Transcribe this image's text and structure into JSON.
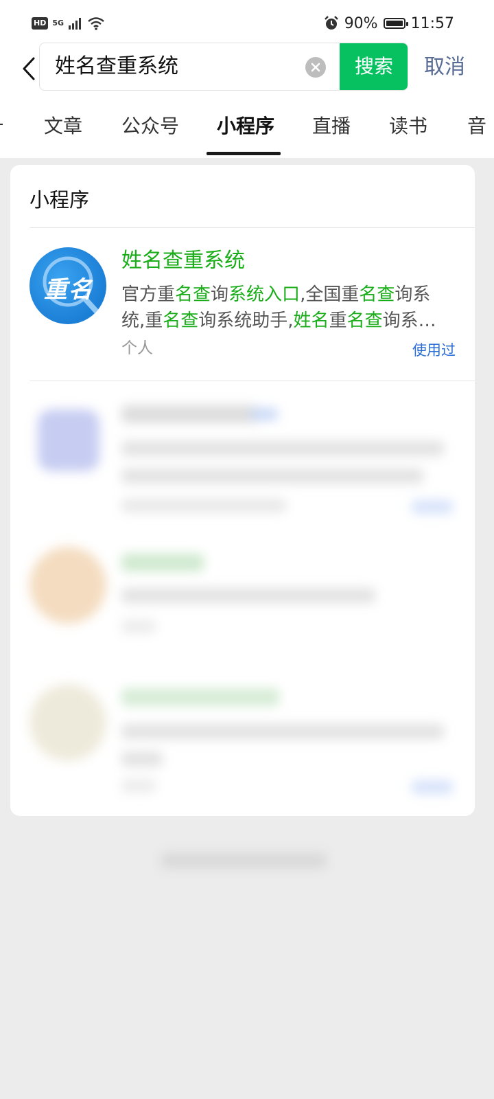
{
  "status_bar": {
    "left_badge": "HD",
    "signal_label": "5G",
    "battery_percent": "90%",
    "time": "11:57"
  },
  "search": {
    "query": "姓名查重系统",
    "search_button": "搜索",
    "cancel_label": "取消"
  },
  "tabs": [
    {
      "label": "文章"
    },
    {
      "label": "公众号"
    },
    {
      "label": "小程序",
      "active": true
    },
    {
      "label": "直播"
    },
    {
      "label": "读书"
    },
    {
      "label": "音"
    }
  ],
  "section": {
    "title": "小程序"
  },
  "result": {
    "icon_text": "重名",
    "title": "姓名查重系统",
    "desc_parts": [
      {
        "t": "官方重",
        "hl": false
      },
      {
        "t": "名查",
        "hl": true
      },
      {
        "t": "询",
        "hl": false
      },
      {
        "t": "系统入口",
        "hl": true
      },
      {
        "t": ",全国重",
        "hl": false
      },
      {
        "t": "名查",
        "hl": true
      },
      {
        "t": "询系统,重",
        "hl": false
      },
      {
        "t": "名查",
        "hl": true
      },
      {
        "t": "询系统助手,",
        "hl": false
      },
      {
        "t": "姓名",
        "hl": true
      },
      {
        "t": "重",
        "hl": false
      },
      {
        "t": "名查",
        "hl": true
      },
      {
        "t": "询系…",
        "hl": false
      }
    ],
    "meta": "个人",
    "used_label": "使用过"
  },
  "colors": {
    "accent_green": "#07c160",
    "highlight_green": "#1aad19",
    "link_blue": "#576b95"
  }
}
